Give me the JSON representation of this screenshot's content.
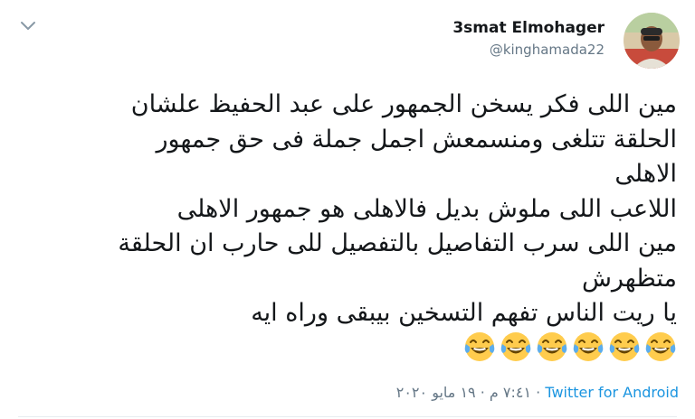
{
  "tweet": {
    "author": {
      "display_name": "3smat Elmohager",
      "handle": "@kinghamada22"
    },
    "text_lines": [
      "مين اللى فكر يسخن الجمهور على عبد الحفيظ علشان",
      "الحلقة تتلغى ومنسمعش اجمل جملة فى حق جمهور",
      "الاهلى",
      "اللاعب اللى ملوش بديل فالاهلى هو جمهور الاهلى",
      "مين اللى سرب التفاصيل بالتفصيل للى حارب ان الحلقة",
      "متظهرش",
      "يا ريت الناس تفهم التسخين بيبقى وراه ايه"
    ],
    "emoji_count": 6,
    "emoji_name": "face-with-tears-of-joy",
    "source": "Twitter for Android",
    "separator": "·",
    "timestamp": "٧:٤١ م · ١٩ مايو ٢٠٢٠"
  },
  "icons": {
    "menu": "chevron-down-icon",
    "avatar": "avatar"
  },
  "colors": {
    "text": "#14171a",
    "secondary": "#657786",
    "link": "#1b95e0",
    "border": "#e6ecf0"
  }
}
